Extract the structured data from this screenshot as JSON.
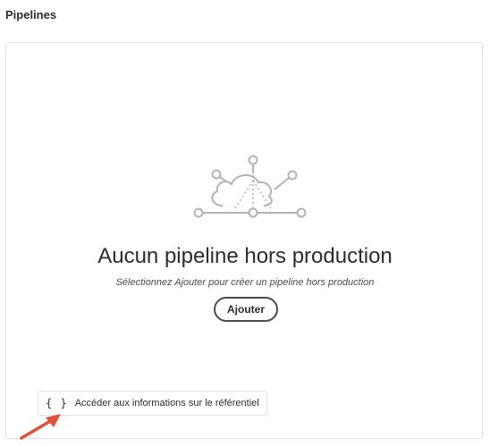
{
  "header": {
    "title": "Pipelines"
  },
  "empty_state": {
    "icon": "cloud-pipeline-icon",
    "title": "Aucun pipeline hors production",
    "subtitle": "Sélectionnez Ajouter pour créer un pipeline hors production",
    "add_button_label": "Ajouter"
  },
  "repo_link": {
    "icon": "braces-icon",
    "icon_glyph": "{ }",
    "label": "Accéder aux informations sur le référentiel"
  },
  "annotation": {
    "icon": "arrow-pointer-icon",
    "color": "#e0513a"
  },
  "colors": {
    "text": "#2c2c2c",
    "border": "#e1e1e1",
    "illustration": "#b3b3b3"
  }
}
